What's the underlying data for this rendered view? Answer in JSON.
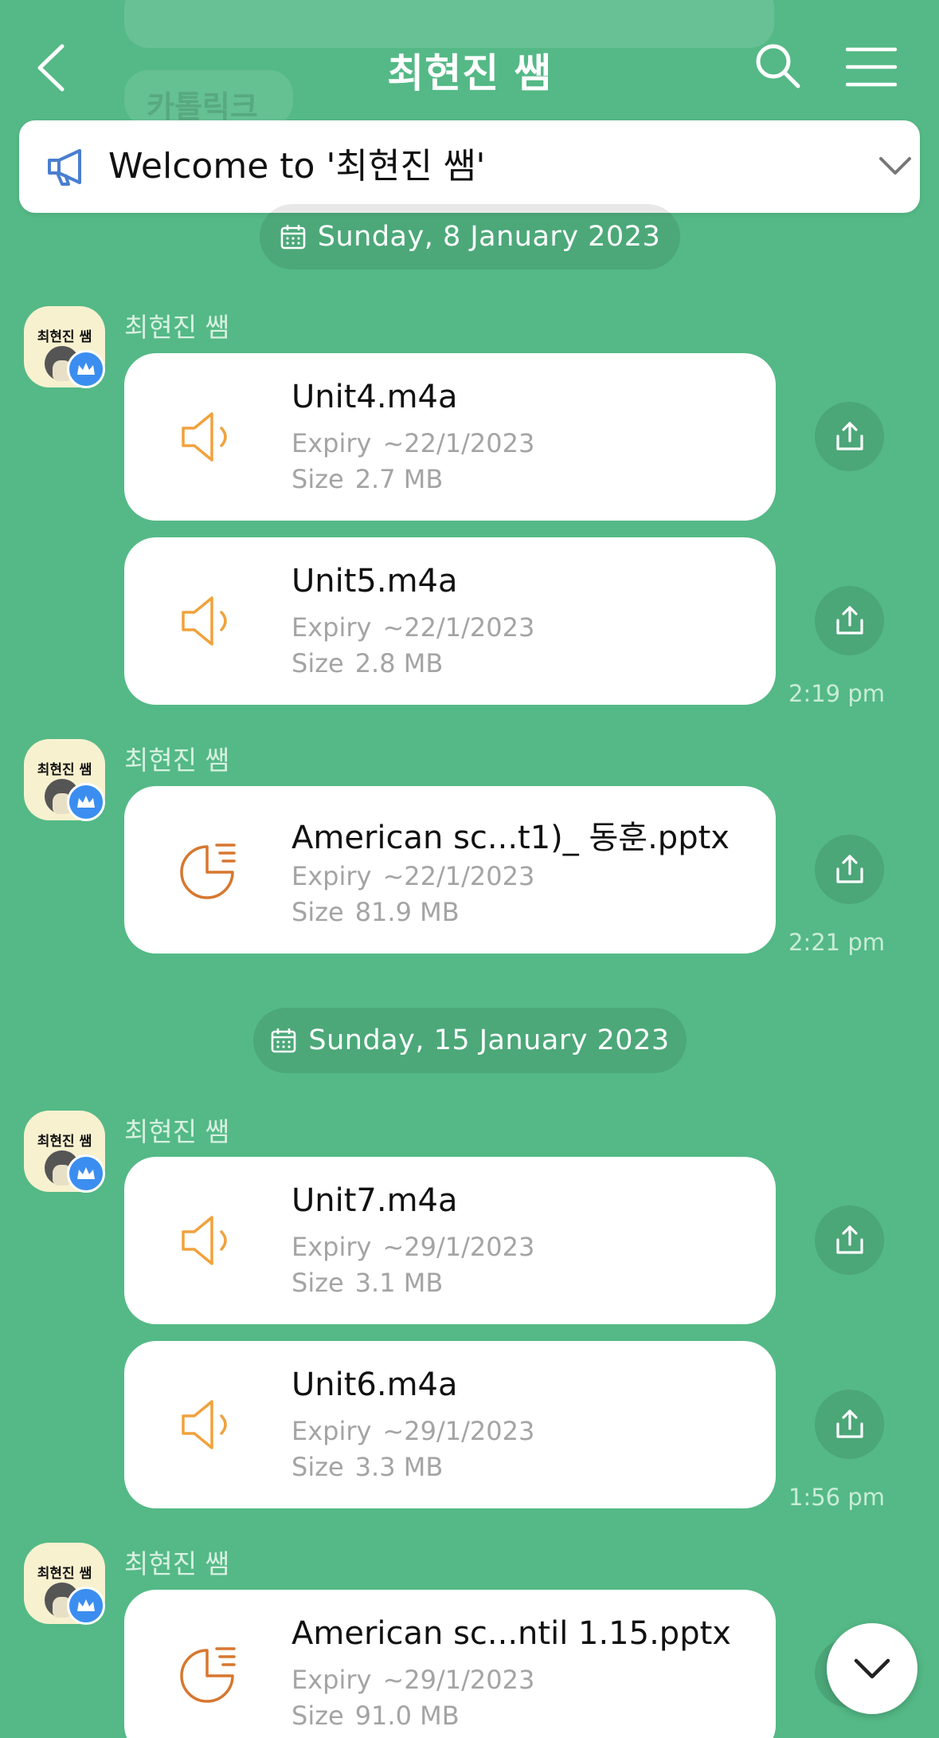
{
  "header": {
    "title": "최현진 쌤",
    "ghost_text": "카톨릭크"
  },
  "notice": {
    "text": "Welcome to '최현진 쌤'"
  },
  "dates": [
    {
      "label": "Sunday, 8 January 2023"
    },
    {
      "label": "Sunday, 15 January 2023"
    }
  ],
  "avatar_text": "최현진 쌤",
  "labels": {
    "expiry": "Expiry",
    "size": "Size"
  },
  "groups": [
    {
      "sender": "최현진 쌤",
      "time": "2:19 pm",
      "files": [
        {
          "name": "Unit4.m4a",
          "expiry": "~22/1/2023",
          "size": "2.7 MB",
          "icon": "audio-icon"
        },
        {
          "name": "Unit5.m4a",
          "expiry": "~22/1/2023",
          "size": "2.8 MB",
          "icon": "audio-icon"
        }
      ]
    },
    {
      "sender": "최현진 쌤",
      "time": "2:21 pm",
      "files": [
        {
          "name": "American sc...t1)_ 동훈.pptx",
          "expiry": "~22/1/2023",
          "size": "81.9 MB",
          "icon": "presentation-icon"
        }
      ]
    },
    {
      "sender": "최현진 쌤",
      "time": "1:56 pm",
      "files": [
        {
          "name": "Unit7.m4a",
          "expiry": "~29/1/2023",
          "size": "3.1 MB",
          "icon": "audio-icon"
        },
        {
          "name": "Unit6.m4a",
          "expiry": "~29/1/2023",
          "size": "3.3 MB",
          "icon": "audio-icon"
        }
      ]
    },
    {
      "sender": "최현진 쌤",
      "time": "",
      "files": [
        {
          "name": "American sc...ntil 1.15.pptx",
          "expiry": "~29/1/2023",
          "size": "91.0 MB",
          "icon": "presentation-icon"
        }
      ]
    }
  ],
  "colors": {
    "background": "#54b986",
    "audio_icon": "#f0a23c",
    "presentation_icon": "#d7772f",
    "megaphone": "#4a7fd0",
    "crown_badge": "#3b8ef0"
  }
}
